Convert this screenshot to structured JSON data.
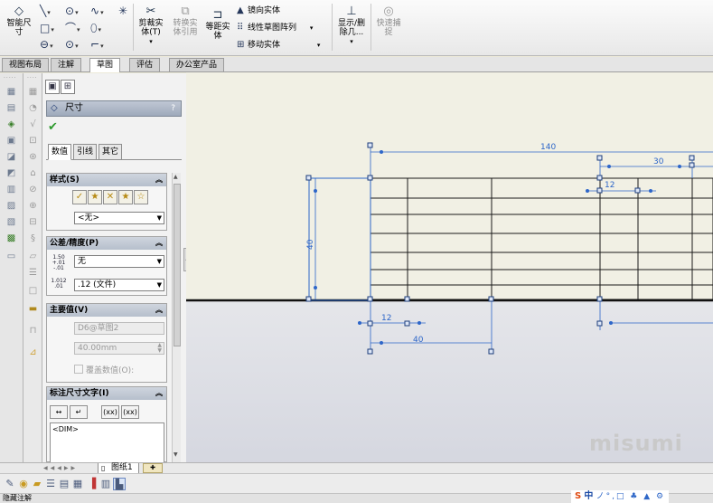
{
  "ribbon": {
    "smart_dimension": "智能尺\n寸",
    "trim": "剪裁实\n体(T)",
    "convert": "转换实\n体引用",
    "offset": "等距实\n体",
    "mirror": "镜向实体",
    "linear_pattern": "线性草图阵列",
    "move": "移动实体",
    "show_delete": "显示/删\n除几...",
    "quick_snap": "快速捕\n捉"
  },
  "tabs": [
    "视图布局",
    "注解",
    "草图",
    "评估",
    "办公室产品"
  ],
  "active_tab": "草图",
  "pm": {
    "title": "尺寸",
    "help": "?",
    "subtabs": [
      "数值",
      "引线",
      "其它"
    ],
    "style_group": {
      "title": "样式(S)",
      "select": "<无>"
    },
    "tolerance_group": {
      "title": "公差/精度(P)",
      "tol_value": "无",
      "precision_value": ".12 (文件)",
      "tol_icon_text": "1.50 +.01 -.01",
      "prec_icon_text": "1.012 .01"
    },
    "primary_group": {
      "title": "主要值(V)",
      "name_field": "D6@草图2",
      "value_field": "40.00mm",
      "override_label": "覆盖数值(O):"
    },
    "dimtext_group": {
      "title": "标注尺寸文字(I)",
      "btn_xx1": "(xx)",
      "btn_xx2": "(xx)",
      "dim_text": "<DIM>"
    }
  },
  "graphics": {
    "dims": {
      "d140": "140",
      "d30": "30",
      "d12_top": "12",
      "d40_left": "40",
      "d12_bottom": "12",
      "d40_bottom": "40"
    },
    "watermark": "misumi"
  },
  "sheet": {
    "tab_label": "图纸1"
  },
  "status_text": "隐藏注解",
  "ime": {
    "s": "S",
    "zh": "中",
    "rest": "ノ°,□ ♣ ▲ ⚙"
  },
  "colors": {
    "dim_blue": "#2d66c9",
    "geometry": "#1a1a1a",
    "pm_header": "#a9b3c3"
  }
}
